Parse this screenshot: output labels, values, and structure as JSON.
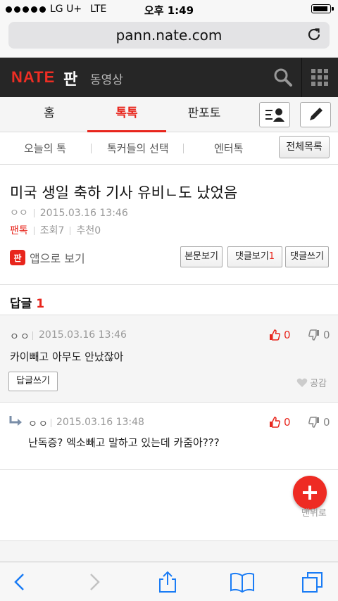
{
  "status_bar": {
    "carrier": "LG U+",
    "network": "LTE",
    "time": "오후 1:49"
  },
  "browser": {
    "url": "pann.nate.com"
  },
  "header": {
    "logo": "NATE",
    "section": "판",
    "video": "동영상"
  },
  "main_tabs": [
    {
      "label": "홈"
    },
    {
      "label": "톡톡"
    },
    {
      "label": "판포토"
    }
  ],
  "sub_tabs": {
    "items": [
      {
        "label": "오늘의 톡"
      },
      {
        "label": "톡커들의 선택"
      },
      {
        "label": "엔터톡"
      }
    ],
    "all_list": "전체목록"
  },
  "article": {
    "title": "미국 생일 축하 기사 유비ㄴ도 났었음",
    "author": "ㅇㅇ",
    "date": "2015.03.16 13:46",
    "category": "팬톡",
    "views_label": "조회",
    "views": "7",
    "recommend_label": "추천",
    "recommend": "0",
    "app_badge": "판",
    "app_view": "앱으로 보기",
    "btn_body": "본문보기",
    "btn_comments": "댓글보기",
    "btn_comments_count": "1",
    "btn_write": "댓글쓰기"
  },
  "replies": {
    "label": "답글",
    "count": "1",
    "items": [
      {
        "author": "ㅇㅇ",
        "date": "2015.03.16 13:46",
        "text": "카이빼고 아무도 안났잖아",
        "up": "0",
        "down": "0",
        "reply_btn": "답글쓰기",
        "empathy": "공감"
      },
      {
        "author": "ㅇㅇ",
        "date": "2015.03.16 13:48",
        "text": "난독증? 엑소빼고 말하고 있는데 카줌아???",
        "up": "0",
        "down": "0"
      }
    ]
  },
  "floating": {
    "top_label": "맨위로"
  },
  "colors": {
    "accent": "#e8251c",
    "header_bg": "#262626"
  }
}
